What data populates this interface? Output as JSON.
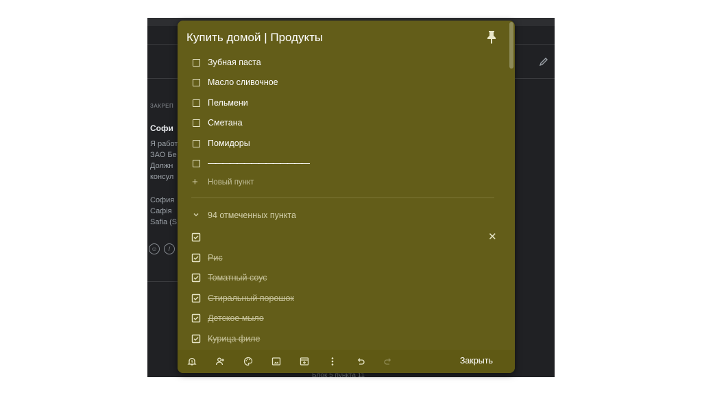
{
  "background": {
    "pinned_label": "ЗАКРЕП",
    "card_title": "Софи",
    "card_lines": [
      "Я работ",
      "ЗАО Бе",
      "Должн",
      "консул"
    ],
    "card_names": [
      "София",
      "Сафія",
      "Safia (S"
    ],
    "footer_text": "Блок 5 пункта 11"
  },
  "note": {
    "title": "Купить домой | Продукты",
    "items": [
      {
        "text": "Зубная паста",
        "checked": false
      },
      {
        "text": "Масло сливочное",
        "checked": false
      },
      {
        "text": "Пельмени",
        "checked": false
      },
      {
        "text": "Сметана",
        "checked": false
      },
      {
        "text": "Помидоры",
        "checked": false
      },
      {
        "text": "——————————————",
        "checked": false
      }
    ],
    "new_item_placeholder": "Новый пункт",
    "completed_label": "94 отмеченных пункта",
    "completed_items": [
      {
        "text": "",
        "checked": true
      },
      {
        "text": "Рис",
        "checked": true
      },
      {
        "text": "Томатный соус",
        "checked": true
      },
      {
        "text": "Стиральный порошок",
        "checked": true
      },
      {
        "text": "Детское мыло",
        "checked": true
      },
      {
        "text": "Курица филе",
        "checked": true
      }
    ],
    "toolbar": {
      "icons": [
        "reminder-icon",
        "collaborator-icon",
        "palette-icon",
        "image-icon",
        "archive-icon",
        "more-icon",
        "undo-icon",
        "redo-icon"
      ],
      "close_label": "Закрыть"
    }
  },
  "colors": {
    "note_background": "#635d19",
    "app_background": "#202124"
  }
}
